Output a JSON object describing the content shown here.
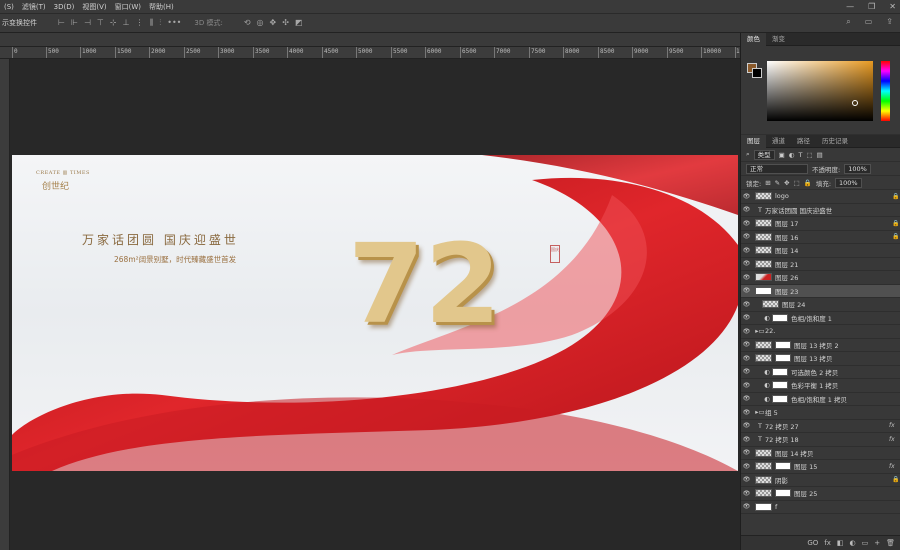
{
  "menubar": {
    "items": [
      "(S)",
      "滤镜(T)",
      "3D(D)",
      "视图(V)",
      "窗口(W)",
      "帮助(H)"
    ],
    "window_controls": [
      "—",
      "❐",
      "✕"
    ]
  },
  "options": {
    "label": "示变换控件",
    "more": "•••",
    "mode_3d": "3D 模式:"
  },
  "ruler": {
    "labels": [
      "0",
      "500",
      "1000",
      "1500",
      "2000",
      "2500",
      "3000",
      "3500",
      "4000",
      "4500",
      "5000",
      "5500",
      "6000",
      "6500",
      "7000",
      "7500",
      "8000",
      "8500",
      "9000",
      "9500",
      "10000",
      "1"
    ]
  },
  "canvas": {
    "logo_en": "CREATE ▥ TIMES",
    "logo_cn": "创世纪",
    "title": "万家话团圆 国庆迎盛世",
    "subtitle": "268m²阔景别墅，时代臻藏盛世首发",
    "number": "72",
    "stamp": "国庆"
  },
  "panels": {
    "color_tabs": [
      "颜色",
      "渐变"
    ],
    "layer_tabs": [
      "图层",
      "通道",
      "路径",
      "历史记录"
    ],
    "filter_kind": "类型",
    "blend_mode": "正常",
    "opacity_label": "不透明度:",
    "opacity_value": "100%",
    "lock_label": "锁定:",
    "fill_label": "填充:",
    "fill_value": "100%",
    "fg_color": "#8b5a2b",
    "bg_color": "#000000"
  },
  "layers": [
    {
      "name": "logo",
      "type": "raster",
      "lock": true
    },
    {
      "name": "万家话团圆 国庆迎盛世",
      "type": "text"
    },
    {
      "name": "图层 17",
      "type": "raster",
      "lock": true
    },
    {
      "name": "图层 16",
      "type": "raster",
      "lock": true
    },
    {
      "name": "图层 14",
      "type": "raster"
    },
    {
      "name": "图层 21",
      "type": "raster"
    },
    {
      "name": "图层 26",
      "type": "raster-red"
    },
    {
      "name": "图层 23",
      "type": "raster-white",
      "selected": true
    },
    {
      "name": "图层 24",
      "type": "raster",
      "clip": true
    },
    {
      "name": "色相/饱和度 1",
      "type": "adjust"
    },
    {
      "name": "22.",
      "type": "group"
    },
    {
      "name": "图层 13 拷贝 2",
      "type": "raster-mask"
    },
    {
      "name": "图层 13 拷贝",
      "type": "raster-mask"
    },
    {
      "name": "可选颜色 2 拷贝",
      "type": "adjust"
    },
    {
      "name": "色彩平衡 1 拷贝",
      "type": "adjust"
    },
    {
      "name": "色相/饱和度 1 拷贝",
      "type": "adjust"
    },
    {
      "name": "组 5",
      "type": "group"
    },
    {
      "name": "72 拷贝 27",
      "type": "text",
      "fx": true
    },
    {
      "name": "72 拷贝 18",
      "type": "text",
      "fx": true
    },
    {
      "name": "图层 14 拷贝",
      "type": "raster"
    },
    {
      "name": "图层 15",
      "type": "raster-mask",
      "fx": true
    },
    {
      "name": "阴影",
      "type": "raster",
      "lock": true
    },
    {
      "name": "图层 25",
      "type": "raster-mask"
    },
    {
      "name": "f",
      "type": "raster-white"
    }
  ],
  "layer_footer_icons": [
    "GO",
    "fx",
    "◧",
    "◐",
    "▭",
    "+",
    "🗑"
  ]
}
